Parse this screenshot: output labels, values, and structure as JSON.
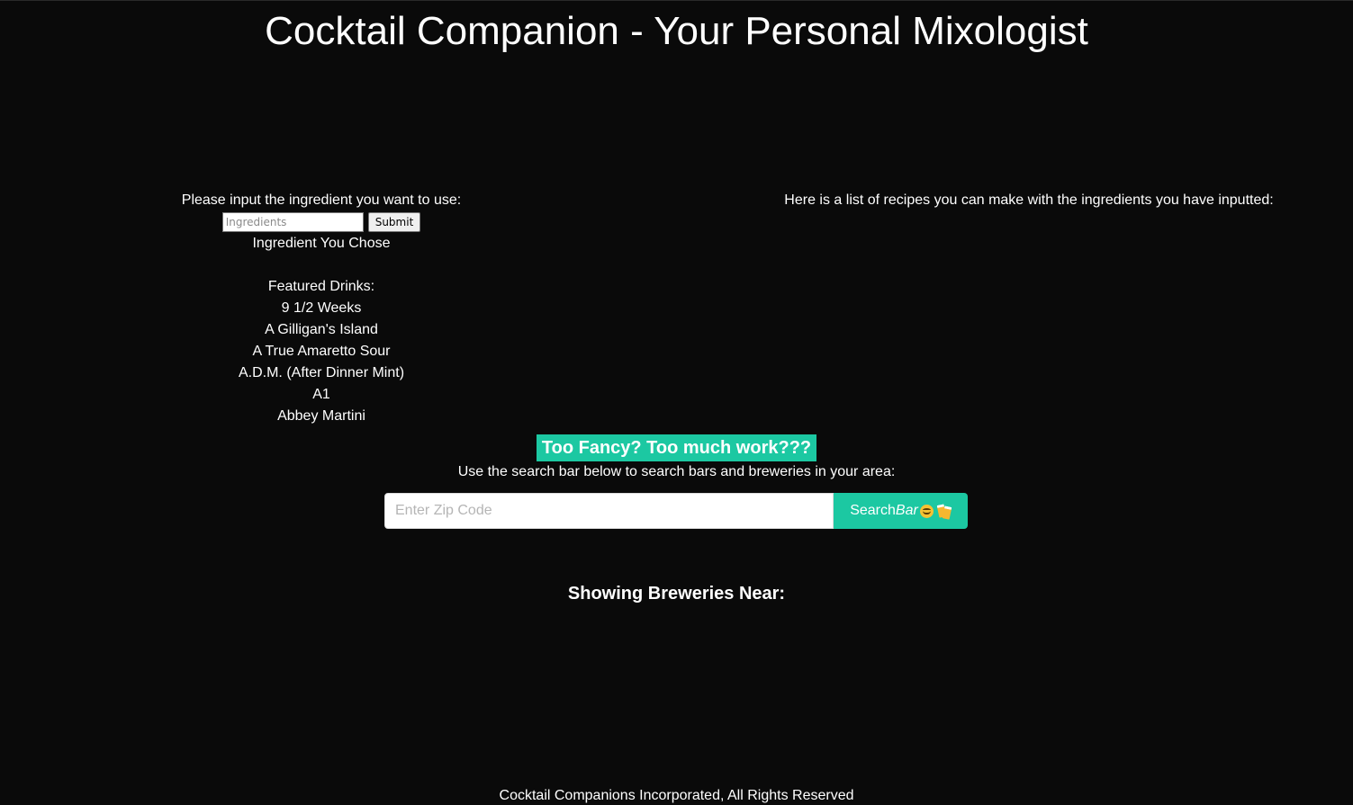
{
  "header": {
    "title": "Cocktail Companion - Your Personal Mixologist"
  },
  "ingredient_panel": {
    "prompt": "Please input the ingredient you want to use:",
    "input_placeholder": "Ingredients",
    "input_value": "",
    "submit_label": "Submit",
    "chosen_label": "Ingredient You Chose",
    "featured_heading": "Featured Drinks:",
    "featured_drinks": [
      "9 1/2 Weeks",
      "A Gilligan's Island",
      "A True Amaretto Sour",
      "A.D.M. (After Dinner Mint)",
      "A1",
      "Abbey Martini"
    ]
  },
  "recipes_panel": {
    "heading": "Here is a list of recipes you can make with the ingredients you have inputted:"
  },
  "bar_search": {
    "highlight": "Too Fancy? Too much work???",
    "instructions": "Use the search bar below to search bars and breweries in your area:",
    "zip_placeholder": "Enter Zip Code",
    "zip_value": "",
    "button_label_plain": "Search",
    "button_label_italic": "Bar",
    "button_icons": [
      "smiling-face-icon",
      "clinking-beer-mugs-icon"
    ],
    "results_heading": "Showing Breweries Near:"
  },
  "footer": {
    "text": "Cocktail Companions Incorporated, All Rights Reserved"
  },
  "colors": {
    "background": "#0a0a0a",
    "text": "#ffffff",
    "accent": "#1cc8a2"
  }
}
